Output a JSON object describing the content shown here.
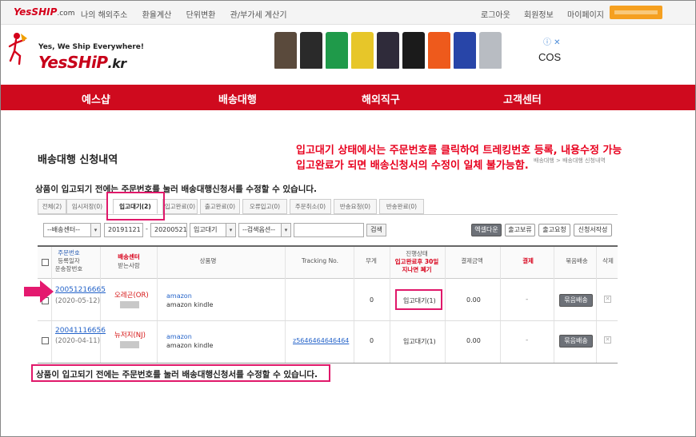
{
  "topbar": {
    "logo": "YesSHIP",
    "logo_domain": ".com",
    "links": [
      "나의 해외주소",
      "환율계산",
      "단위변환",
      "관/부가세 계산기"
    ],
    "right_links": [
      "로그아웃",
      "회원정보",
      "마이페이지"
    ],
    "colors": {
      "badge": "#f5a020"
    }
  },
  "header": {
    "tagline": "Yes, We Ship Everywhere!",
    "brand": "YesSHiP",
    "brand_suffix": ".kr",
    "ad_cta": "COS",
    "ad_info": "ⓘ ✕"
  },
  "nav": {
    "items": [
      "예스샵",
      "배송대행",
      "해외직구",
      "고객센터"
    ],
    "color": "#cf0a1e"
  },
  "annotations": {
    "line1": "입고대기 상태에서는 주문번호를 클릭하여 트레킹번호 등록, 내용수정 가능",
    "line2": "입고완료가 되면 배송신청서의 수정이 일체 불가능함."
  },
  "page": {
    "title": "배송대행 신청내역",
    "breadcrumb": "배송대행 > 배송대행 신청내역",
    "notice": "상품이 입고되기 전에는 주문번호를 눌러 배송대행신청서를 수정할 수 있습니다.",
    "bottom_notice": "상품이 입고되기 전에는 주문번호를 눌러 배송대행신청서를 수정할 수 있습니다."
  },
  "tabs": [
    {
      "label": "전체(2)"
    },
    {
      "label": "임시저장(0)"
    },
    {
      "label": "입고대기(2)",
      "active": true
    },
    {
      "label": "입고완료(0)"
    },
    {
      "label": "출고완료(0)"
    },
    {
      "label": "오류입고(0)"
    },
    {
      "label": "주문취소(0)"
    },
    {
      "label": "반송요청(0)"
    },
    {
      "label": "반송완료(0)"
    }
  ],
  "filters": {
    "center": "--배송센터--",
    "date_from": "20191121",
    "date_sep": "-",
    "date_to": "20200521",
    "status": "입고대기",
    "search_option": "--검색옵션--",
    "search_value": "",
    "search_button": "검색"
  },
  "actions": [
    "엑셀다운",
    "출고보류",
    "출고요청",
    "신청서작성"
  ],
  "table": {
    "headers": {
      "order_no": "주문번호",
      "reg_date": "등록일자",
      "tracking_label": "운송장번호",
      "center": "배송센터",
      "recipient": "받는사람",
      "product": "상품명",
      "tracking": "Tracking No.",
      "weight": "무게",
      "status_1": "진행상태",
      "status_2": "입고완료후 30일",
      "status_3": "지나면 폐기",
      "amount": "결제금액",
      "payment": "결제",
      "bundle": "묶음배송",
      "delete": "삭제"
    },
    "rows": [
      {
        "order_no": "20051216665",
        "date": "(2020-05-12)",
        "center": "오레곤(OR)",
        "shop": "amazon",
        "product": "amazon kindle",
        "tracking": "",
        "weight": "0",
        "status": "입고대기(1)",
        "amount": "0.00",
        "payment": "-",
        "bundle": "묶음배송",
        "delete": "✕"
      },
      {
        "order_no": "20041116656",
        "date": "(2020-04-11)",
        "center": "뉴저지(NJ)",
        "shop": "amazon",
        "product": "amazon kindle",
        "tracking": "z5646464646464",
        "weight": "0",
        "status": "입고대기(1)",
        "amount": "0.00",
        "payment": "-",
        "bundle": "묶음배송",
        "delete": "✕"
      }
    ]
  },
  "highlight_color": "#e0186a"
}
